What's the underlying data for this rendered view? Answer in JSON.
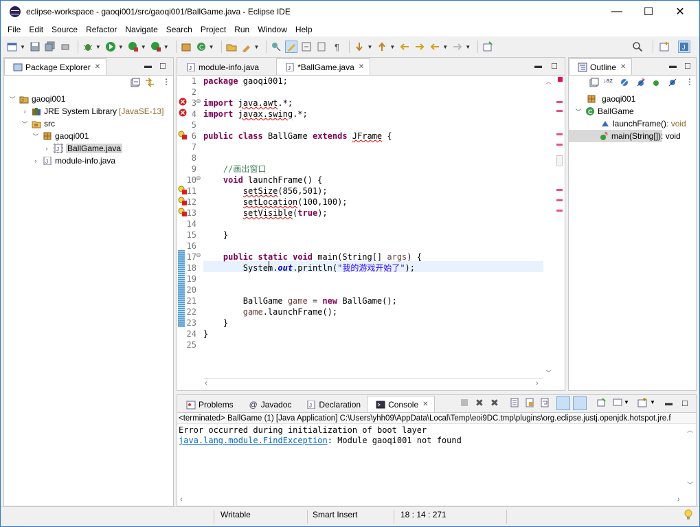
{
  "window": {
    "title": "eclipse-workspace - gaoqi001/src/gaoqi001/BallGame.java - Eclipse IDE",
    "minimize": "—",
    "maximize": "☐",
    "close": "✕"
  },
  "menu": [
    "File",
    "Edit",
    "Source",
    "Refactor",
    "Navigate",
    "Search",
    "Project",
    "Run",
    "Window",
    "Help"
  ],
  "package_explorer": {
    "tab_label": "Package Explorer",
    "tree": [
      {
        "label": "gaoqi001",
        "suffix": ""
      },
      {
        "label": "JRE System Library",
        "suffix": "[JavaSE-13]"
      },
      {
        "label": "src",
        "suffix": ""
      },
      {
        "label": "gaoqi001",
        "suffix": ""
      },
      {
        "label": "BallGame.java",
        "suffix": ""
      },
      {
        "label": "module-info.java",
        "suffix": ""
      }
    ]
  },
  "editor": {
    "tabs": [
      "module-info.java",
      "*BallGame.java"
    ],
    "line_numbers": [
      "1",
      "2",
      "3",
      "4",
      "5",
      "6",
      "7",
      "8",
      "9",
      "10",
      "11",
      "12",
      "13",
      "14",
      "15",
      "16",
      "17",
      "18",
      "19",
      "20",
      "21",
      "22",
      "23",
      "24",
      "25"
    ],
    "lines": {
      "l1a": "package",
      "l1b": " gaoqi001;",
      "l3a": "import",
      "l3b": " ",
      "l3c": "java.awt",
      "l3d": ".*;",
      "l4a": "import",
      "l4b": " ",
      "l4c": "javax.swing",
      "l4d": ".*;",
      "l6a": "public",
      "l6b": " ",
      "l6c": "class",
      "l6d": " BallGame ",
      "l6e": "extends",
      "l6f": " ",
      "l6g": "JFrame",
      "l6h": " {",
      "l9": "    //画出窗口",
      "l10a": "    ",
      "l10b": "void",
      "l10c": " launchFrame() {",
      "l11a": "        ",
      "l11b": "setSize",
      "l11c": "(856,501);",
      "l12a": "        ",
      "l12b": "setLocation",
      "l12c": "(100,100);",
      "l13a": "        ",
      "l13b": "setVisible",
      "l13c": "(",
      "l13d": "true",
      "l13e": ");",
      "l15": "    }",
      "l17a": "    ",
      "l17b": "public",
      "l17c": " ",
      "l17d": "static",
      "l17e": " ",
      "l17f": "void",
      "l17g": " main(String[] ",
      "l17h": "args",
      "l17i": ") {",
      "l18a": "        System.",
      "l18b": "out",
      "l18c": ".println(",
      "l18d": "\"我的游戏开始了\"",
      "l18e": ");",
      "l21a": "        BallGame ",
      "l21b": "game",
      "l21c": " = ",
      "l21d": "new",
      "l21e": " BallGame();",
      "l22a": "        ",
      "l22b": "game",
      "l22c": ".launchFrame();",
      "l23": "    }",
      "l24": "}"
    }
  },
  "outline": {
    "tab_label": "Outline",
    "items": [
      {
        "label": "gaoqi001",
        "suffix": ""
      },
      {
        "label": "BallGame",
        "suffix": ""
      },
      {
        "label": "launchFrame()",
        "suffix": " : void"
      },
      {
        "label": "main(String[])",
        "suffix": " : void"
      }
    ]
  },
  "bottom": {
    "tabs": [
      "Problems",
      "Javadoc",
      "Declaration",
      "Console"
    ],
    "terminated": "<terminated> BallGame (1) [Java Application] C:\\Users\\yhh09\\AppData\\Local\\Temp\\eoi9DC.tmp\\plugins\\org.eclipse.justj.openjdk.hotspot.jre.f",
    "console_line1": "Error occurred during initialization of boot layer",
    "exception_link": "java.lang.module.FindException",
    "exception_msg": ": Module gaoqi001 not found"
  },
  "status": {
    "writable": "Writable",
    "insert": "Smart Insert",
    "position": "18 : 14 : 271"
  },
  "colors": {
    "keyword": "#7f0055",
    "comment": "#3f7f5f",
    "string": "#2a00ff",
    "link": "#0066cc",
    "error": "#e00000"
  }
}
